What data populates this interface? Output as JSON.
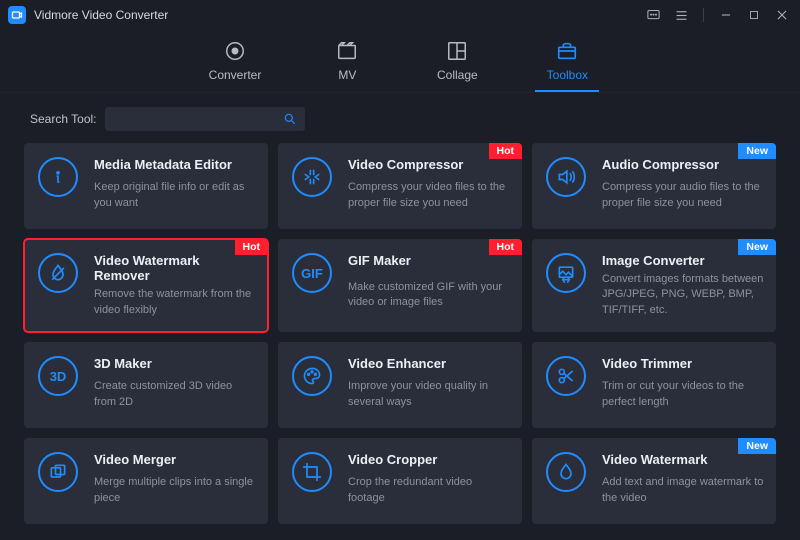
{
  "app": {
    "title": "Vidmore Video Converter"
  },
  "nav": {
    "items": [
      {
        "label": "Converter"
      },
      {
        "label": "MV"
      },
      {
        "label": "Collage"
      },
      {
        "label": "Toolbox"
      }
    ]
  },
  "search": {
    "label": "Search Tool:",
    "value": ""
  },
  "badges": {
    "hot": "Hot",
    "new": "New"
  },
  "tools": [
    {
      "title": "Media Metadata Editor",
      "desc": "Keep original file info or edit as you want"
    },
    {
      "title": "Video Compressor",
      "desc": "Compress your video files to the proper file size you need"
    },
    {
      "title": "Audio Compressor",
      "desc": "Compress your audio files to the proper file size you need"
    },
    {
      "title": "Video Watermark Remover",
      "desc": "Remove the watermark from the video flexibly"
    },
    {
      "title": "GIF Maker",
      "desc": "Make customized GIF with your video or image files"
    },
    {
      "title": "Image Converter",
      "desc": "Convert images formats between JPG/JPEG, PNG, WEBP, BMP, TIF/TIFF, etc."
    },
    {
      "title": "3D Maker",
      "desc": "Create customized 3D video from 2D"
    },
    {
      "title": "Video Enhancer",
      "desc": "Improve your video quality in several ways"
    },
    {
      "title": "Video Trimmer",
      "desc": "Trim or cut your videos to the perfect length"
    },
    {
      "title": "Video Merger",
      "desc": "Merge multiple clips into a single piece"
    },
    {
      "title": "Video Cropper",
      "desc": "Crop the redundant video footage"
    },
    {
      "title": "Video Watermark",
      "desc": "Add text and image watermark to the video"
    }
  ]
}
